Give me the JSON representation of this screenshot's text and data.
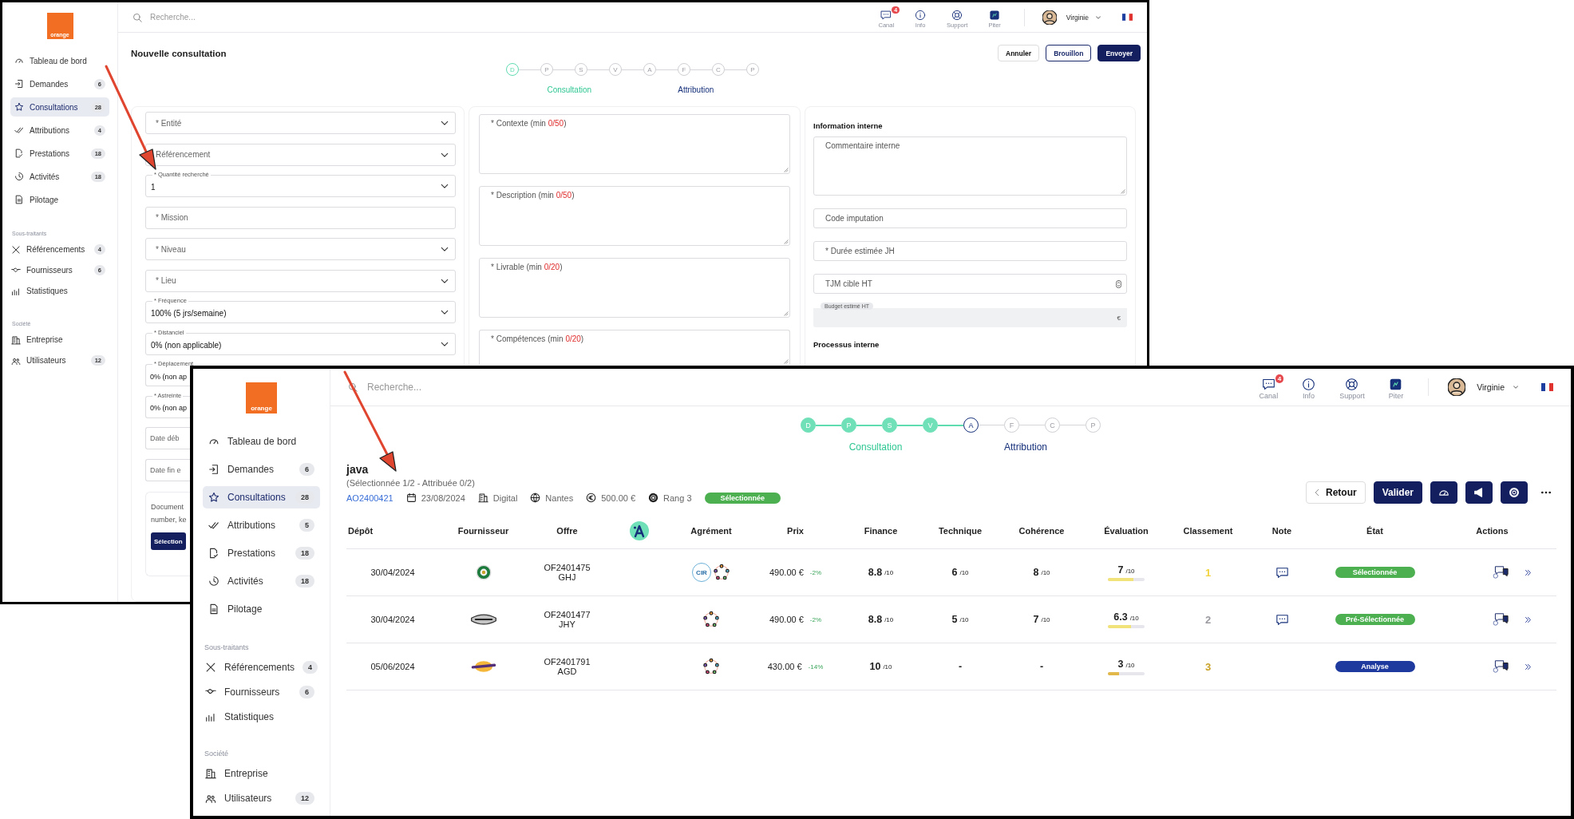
{
  "windows": [
    {
      "kind": "form",
      "logo": "orange",
      "search": {
        "placeholder": "Recherche..."
      },
      "topbar": {
        "icons": [
          {
            "label": "Canal",
            "badge": "4"
          },
          {
            "label": "Info"
          },
          {
            "label": "Support"
          },
          {
            "label": "Piter"
          }
        ],
        "user": "Virginie"
      },
      "sidebar": {
        "items": [
          {
            "label": "Tableau de bord",
            "selected": false
          },
          {
            "label": "Demandes",
            "count": "6",
            "selected": false
          },
          {
            "label": "Consultations",
            "count": "28",
            "selected": true
          },
          {
            "label": "Attributions",
            "count": "4",
            "selected": false
          },
          {
            "label": "Prestations",
            "count": "18",
            "selected": false
          },
          {
            "label": "Activités",
            "count": "18",
            "selected": false
          },
          {
            "label": "Pilotage",
            "selected": false
          }
        ],
        "sections": [
          {
            "title": "Sous-traitants",
            "items": [
              {
                "label": "Référencements",
                "count": "4",
                "selected": false
              },
              {
                "label": "Fournisseurs",
                "count": "6",
                "selected": false
              },
              {
                "label": "Statistiques",
                "selected": false
              }
            ]
          },
          {
            "title": "Société",
            "items": [
              {
                "label": "Entreprise",
                "selected": false
              },
              {
                "label": "Utilisateurs",
                "count": "12",
                "selected": false
              }
            ]
          }
        ]
      },
      "stepper": {
        "steps": [
          {
            "letter": "D",
            "done": false,
            "current": true
          },
          {
            "letter": "P",
            "done": false,
            "current": false
          },
          {
            "letter": "S",
            "done": false,
            "current": false
          },
          {
            "letter": "V",
            "done": false,
            "current": false
          },
          {
            "letter": "A",
            "done": false,
            "current": false
          },
          {
            "letter": "F",
            "done": false,
            "current": false
          },
          {
            "letter": "C",
            "done": false,
            "current": false
          },
          {
            "letter": "P",
            "done": false,
            "current": false
          }
        ],
        "phases": [
          "Consultation",
          "Attribution"
        ]
      },
      "title": "Nouvelle consultation",
      "buttons": [
        {
          "label": "Annuler",
          "kind": "outline"
        },
        {
          "label": "Brouillon",
          "kind": "outline-primary"
        },
        {
          "label": "Envoyer",
          "kind": "primary"
        }
      ],
      "fields": [
        {
          "kind": "select",
          "placeholder": "* Entité"
        },
        {
          "kind": "select",
          "placeholder": "Référencement"
        },
        {
          "kind": "select",
          "label": "* Quantité recherché",
          "value": "1"
        },
        {
          "kind": "input",
          "placeholder": "* Mission"
        },
        {
          "kind": "select",
          "placeholder": "* Niveau"
        },
        {
          "kind": "select",
          "placeholder": "* Lieu"
        },
        {
          "kind": "select",
          "label": "* Fréquence",
          "value": "100% (5 jrs/semaine)"
        },
        {
          "kind": "select",
          "label": "* Distanciel",
          "value": "0% (non applicable)"
        },
        {
          "kind": "input",
          "label": "* Déplacement",
          "value": "0% (non ap"
        },
        {
          "kind": "input",
          "label": "* Astreinte",
          "value": "0% (non ap"
        },
        {
          "kind": "input",
          "placeholder": "Date déb"
        },
        {
          "kind": "input",
          "placeholder": "Date fin e"
        }
      ],
      "upload": {
        "lines": [
          "Document",
          "number, ke"
        ],
        "button": "Sélection"
      },
      "texts": [
        {
          "label": "* Contexte (min ",
          "count": "0/50",
          "suffix": ")"
        },
        {
          "label": "* Description (min ",
          "count": "0/50",
          "suffix": ")"
        },
        {
          "label": "* Livrable (min ",
          "count": "0/20",
          "suffix": ")"
        },
        {
          "label": "* Compétences (min ",
          "count": "0/20",
          "suffix": ")"
        }
      ],
      "internal": [
        {
          "kind": "heading",
          "text": "Information interne"
        },
        {
          "kind": "textarea",
          "placeholder": "Commentaire interne"
        },
        {
          "kind": "input",
          "placeholder": "Code imputation"
        },
        {
          "kind": "input",
          "placeholder": "* Durée estimée JH"
        },
        {
          "kind": "number",
          "placeholder": "TJM cible HT"
        },
        {
          "kind": "readonly",
          "label": "Budget estimé HT",
          "suffix": "€"
        },
        {
          "kind": "heading",
          "text": "Processus interne"
        }
      ]
    },
    {
      "kind": "results",
      "logo": "orange",
      "search": {
        "placeholder": "Recherche..."
      },
      "topbar": {
        "icons": [
          {
            "label": "Canal",
            "badge": "4"
          },
          {
            "label": "Info"
          },
          {
            "label": "Support"
          },
          {
            "label": "Piter"
          }
        ],
        "user": "Virginie"
      },
      "sidebar": {
        "items": [
          {
            "label": "Tableau de bord",
            "selected": false
          },
          {
            "label": "Demandes",
            "count": "6",
            "selected": false
          },
          {
            "label": "Consultations",
            "count": "28",
            "selected": true
          },
          {
            "label": "Attributions",
            "count": "5",
            "selected": false
          },
          {
            "label": "Prestations",
            "count": "18",
            "selected": false
          },
          {
            "label": "Activités",
            "count": "18",
            "selected": false
          },
          {
            "label": "Pilotage",
            "selected": false
          }
        ],
        "sections": [
          {
            "title": "Sous-traitants",
            "items": [
              {
                "label": "Référencements",
                "count": "4",
                "selected": false
              },
              {
                "label": "Fournisseurs",
                "count": "6",
                "selected": false
              },
              {
                "label": "Statistiques",
                "selected": false
              }
            ]
          },
          {
            "title": "Société",
            "items": [
              {
                "label": "Entreprise",
                "selected": false
              },
              {
                "label": "Utilisateurs",
                "count": "12",
                "selected": false
              }
            ]
          }
        ]
      },
      "stepper": {
        "steps": [
          {
            "letter": "D",
            "done": true
          },
          {
            "letter": "P",
            "done": true
          },
          {
            "letter": "S",
            "done": true
          },
          {
            "letter": "V",
            "done": true
          },
          {
            "letter": "A",
            "done": false,
            "current": true
          },
          {
            "letter": "F",
            "done": false,
            "current": false
          },
          {
            "letter": "C",
            "done": false,
            "current": false
          },
          {
            "letter": "P",
            "done": false,
            "current": false
          }
        ],
        "phases": [
          "Consultation",
          "Attribution"
        ]
      },
      "title": "java",
      "subtitle": "(Sélectionnée 1/2 - Attribuée 0/2)",
      "meta": {
        "ref": "AO2400421",
        "date": "23/08/2024",
        "domain": "Digital",
        "city": "Nantes",
        "budget": "500.00 €",
        "rank": "Rang 3",
        "status": {
          "text": "Sélectionnée",
          "color": "#4caf50"
        }
      },
      "buttons": [
        {
          "kind": "back",
          "label": "Retour"
        },
        {
          "kind": "primary",
          "label": "Valider"
        },
        {
          "kind": "icon"
        },
        {
          "kind": "icon"
        },
        {
          "kind": "icon"
        },
        {
          "kind": "more"
        }
      ],
      "table": {
        "columns": [
          {
            "label": "Dépôt"
          },
          {
            "label": "Fournisseur"
          },
          {
            "label": "Offre"
          },
          {
            "kind": "icon"
          },
          {
            "label": "Agrément"
          },
          {
            "label": "Prix"
          },
          {
            "label": "Finance"
          },
          {
            "label": "Technique"
          },
          {
            "label": "Cohérence"
          },
          {
            "label": "Évaluation"
          },
          {
            "label": "Classement"
          },
          {
            "label": "Note"
          },
          {
            "label": "État"
          },
          {
            "label": "Actions"
          }
        ],
        "rows": [
          {
            "date": "30/04/2024",
            "logo": {
              "kind": "round"
            },
            "offer": "OF2401475",
            "offer_code": "GHJ",
            "agrements": [
              {
                "kind": "badge",
                "text": "CIR"
              },
              {
                "kind": "ring"
              }
            ],
            "price": "490.00 €",
            "delta": "-2%",
            "finance": {
              "score": "8.8",
              "unit": "/10"
            },
            "technique": {
              "score": "6",
              "unit": "/10"
            },
            "coherence": {
              "score": "8",
              "unit": "/10"
            },
            "evaluation": {
              "score": "7",
              "unit": "/10",
              "level": 0.7,
              "color": "#f2e27a"
            },
            "rank": {
              "text": "1",
              "color": "#f2d33c"
            },
            "note": true,
            "state": {
              "text": "Sélectionnée",
              "color": "#4caf50"
            }
          },
          {
            "date": "30/04/2024",
            "logo": {
              "kind": "banner"
            },
            "offer": "OF2401477",
            "offer_code": "JHY",
            "agrements": [
              {
                "kind": "ring"
              }
            ],
            "price": "490.00 €",
            "delta": "-2%",
            "finance": {
              "score": "8.8",
              "unit": "/10"
            },
            "technique": {
              "score": "5",
              "unit": "/10"
            },
            "coherence": {
              "score": "7",
              "unit": "/10"
            },
            "evaluation": {
              "score": "6.3",
              "unit": "/10",
              "level": 0.63,
              "color": "#f2e27a"
            },
            "rank": {
              "text": "2",
              "color": "#9a9aa0"
            },
            "note": true,
            "state": {
              "text": "Pré-Sélectionnée",
              "color": "#4caf50"
            }
          },
          {
            "date": "05/06/2024",
            "logo": {
              "kind": "oval"
            },
            "offer": "OF2401791",
            "offer_code": "AGD",
            "agrements": [
              {
                "kind": "ring"
              }
            ],
            "price": "430.00 €",
            "delta": "-14%",
            "finance": {
              "score": "10",
              "unit": "/10"
            },
            "technique": {
              "score": "-"
            },
            "coherence": {
              "score": "-"
            },
            "evaluation": {
              "score": "3",
              "unit": "/10",
              "level": 0.3,
              "color": "#e2b84a"
            },
            "rank": {
              "text": "3",
              "color": "#c9a227"
            },
            "note": false,
            "state": {
              "text": "Analyse",
              "color": "#1e3a9e"
            }
          }
        ]
      }
    }
  ]
}
